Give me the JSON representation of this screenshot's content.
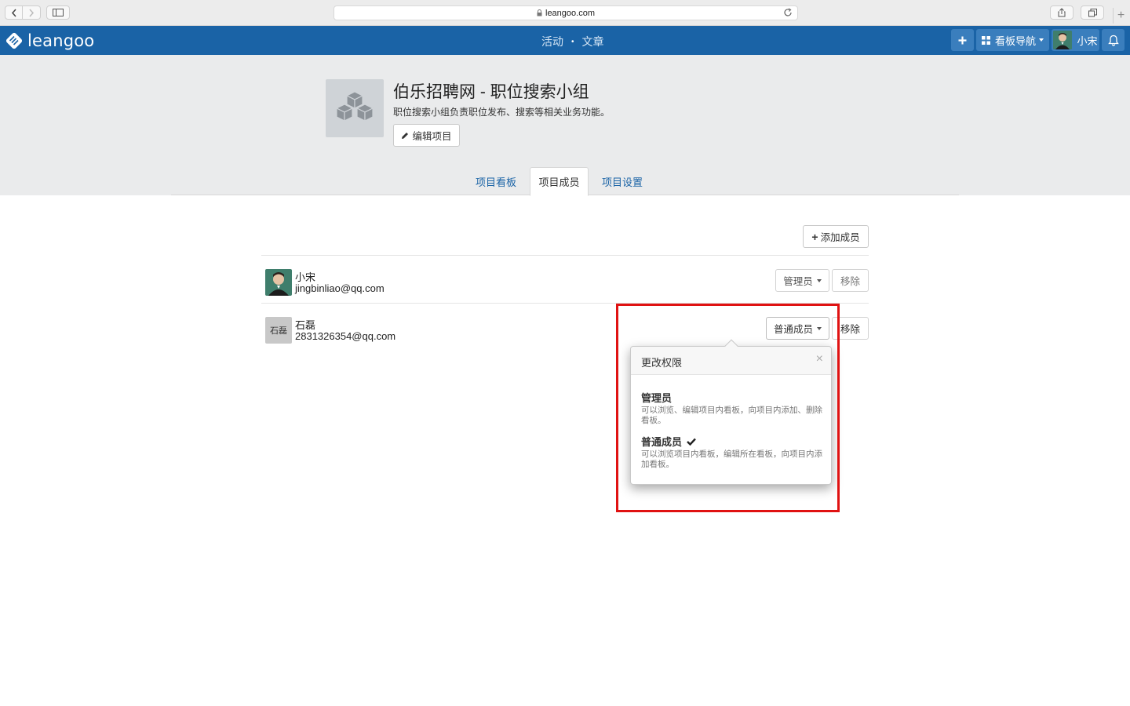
{
  "browser": {
    "url": "leangoo.com"
  },
  "header": {
    "logo_text": "leangoo",
    "nav_activity": "活动",
    "nav_dot": "•",
    "nav_articles": "文章",
    "add_label": "+",
    "board_nav_label": "看板导航",
    "user_name": "小宋"
  },
  "project": {
    "title": "伯乐招聘网 - 职位搜索小组",
    "description": "职位搜索小组负责职位发布、搜索等相关业务功能。",
    "edit_label": "编辑项目",
    "tabs": [
      {
        "label": "项目看板"
      },
      {
        "label": "项目成员"
      },
      {
        "label": "项目设置"
      }
    ]
  },
  "members": {
    "add_label": "添加成员",
    "list": [
      {
        "name": "小宋",
        "email": "jingbinliao@qq.com",
        "role": "管理员",
        "remove": "移除"
      },
      {
        "name": "石磊",
        "email": "2831326354@qq.com",
        "role": "普通成员",
        "remove": "移除",
        "avatar_text": "石磊"
      }
    ]
  },
  "popover": {
    "title": "更改权限",
    "close": "×",
    "options": [
      {
        "title": "管理员",
        "desc": "可以浏览、编辑项目内看板，向项目内添加、删除看板。",
        "selected": false
      },
      {
        "title": "普通成员",
        "desc": "可以浏览项目内看板，编辑所在看板，向项目内添加看板。",
        "selected": true
      }
    ]
  },
  "colors": {
    "header_bg": "#1a63a6",
    "highlight": "#e01212"
  }
}
